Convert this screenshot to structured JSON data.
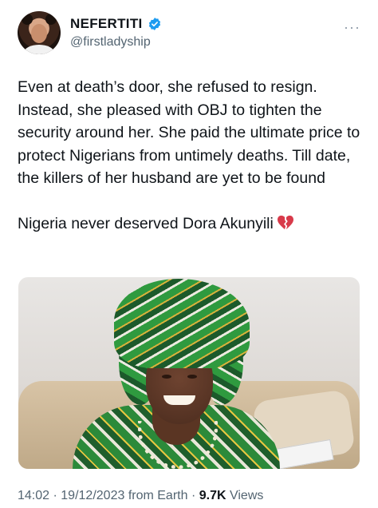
{
  "author": {
    "display_name": "NEFERTITI",
    "handle": "@firstladyship",
    "verified": true,
    "verified_color": "#1d9bf0"
  },
  "header": {
    "more_icon": "more-horizontal-icon",
    "more_glyph": "···"
  },
  "tweet": {
    "paragraph_1": "Even at death’s door, she refused to resign. Instead, she pleased with OBJ to tighten the security around her. She paid the ultimate price to protect Nigerians from untimely deaths. Till date, the killers of her husband are yet to be found",
    "paragraph_2": "Nigeria never deserved Dora Akunyili",
    "emoji": "broken-heart-icon"
  },
  "media": {
    "type": "photo"
  },
  "meta": {
    "time": "14:02",
    "separator": "·",
    "date": "19/12/2023",
    "source": "from Earth",
    "views_count": "9.7K",
    "views_label": "Views"
  },
  "colors": {
    "text": "#0f1419",
    "secondary": "#536471",
    "emoji_red": "#d83a4a"
  }
}
